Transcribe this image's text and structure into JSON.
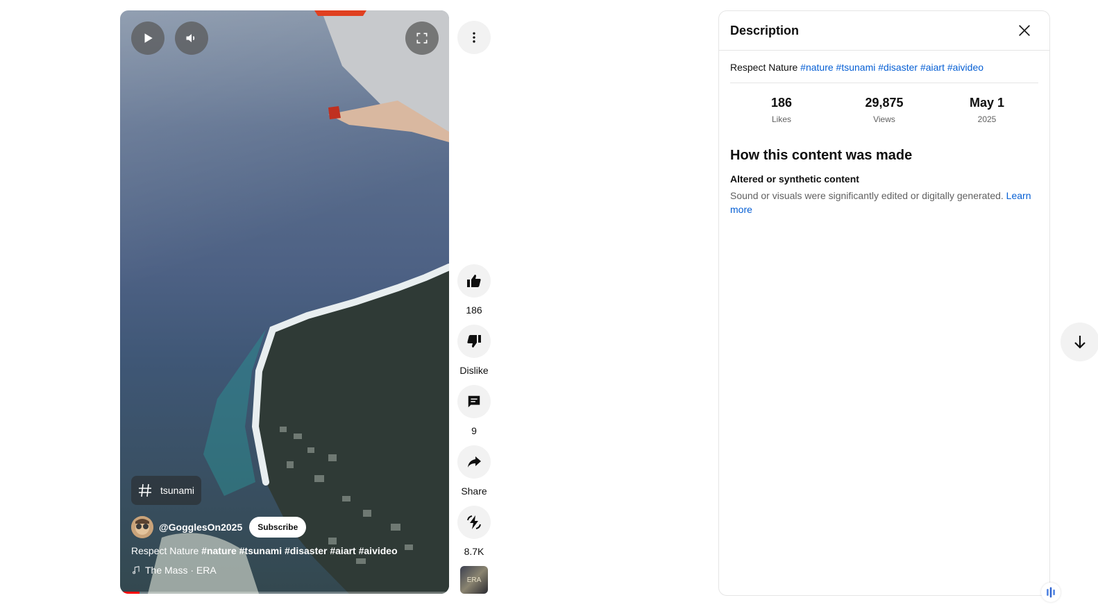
{
  "video": {
    "hashtag_chip": "tsunami",
    "channel_name": "@GogglesOn2025",
    "subscribe_label": "Subscribe",
    "title_plain": "Respect Nature",
    "title_tags": "#nature #tsunami #disaster #aiart #aivideo",
    "music": "The Mass · ERA",
    "progress_fraction": 0.06,
    "thumb_text": "ERA"
  },
  "actions": {
    "like_count": "186",
    "dislike_label": "Dislike",
    "comment_count": "9",
    "share_label": "Share",
    "remix_count": "8.7K"
  },
  "description_panel": {
    "title": "Description",
    "text": "Respect Nature",
    "tags": [
      "#nature",
      "#tsunami",
      "#disaster",
      "#aiart",
      "#aivideo"
    ],
    "stats": [
      {
        "value": "186",
        "label": "Likes"
      },
      {
        "value": "29,875",
        "label": "Views"
      },
      {
        "value": "May 1",
        "label": "2025"
      }
    ],
    "how_made_title": "How this content was made",
    "altered_title": "Altered or synthetic content",
    "altered_desc": "Sound or visuals were significantly edited or digitally generated.",
    "learn_more": "Learn more"
  },
  "icons": [
    "play-icon",
    "volume-icon",
    "fullscreen-icon",
    "more-vert-icon",
    "hashtag-icon",
    "music-note-icon",
    "thumb-up-icon",
    "thumb-down-icon",
    "comment-icon",
    "share-icon",
    "remix-icon",
    "close-icon",
    "arrow-down-icon",
    "assistant-icon"
  ],
  "colors": {
    "link": "#065fd4",
    "progress": "#ff0000",
    "button_bg": "#f2f2f2"
  }
}
